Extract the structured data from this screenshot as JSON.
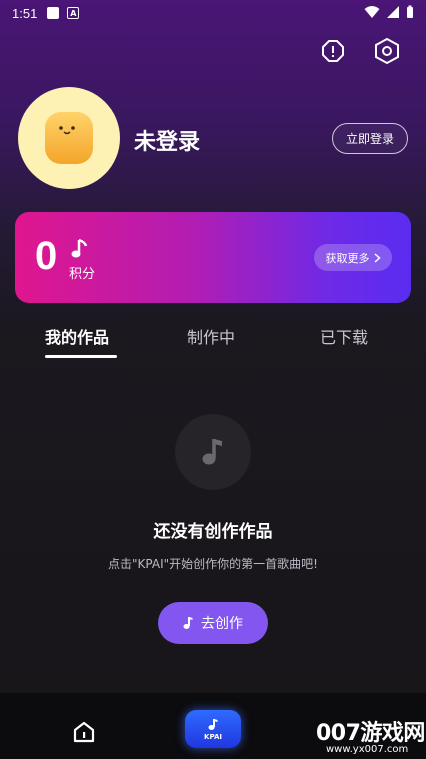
{
  "status_bar": {
    "time": "1:51",
    "app_badge": "A"
  },
  "header": {
    "alert_icon": "alert-circle-icon",
    "settings_icon": "hexagon-settings-icon"
  },
  "profile": {
    "username": "未登录",
    "login_button": "立即登录",
    "avatar_icon": "cute-tofu-avatar"
  },
  "points": {
    "value": "0",
    "label": "积分",
    "more_button": "获取更多"
  },
  "tabs": [
    {
      "label": "我的作品",
      "active": true
    },
    {
      "label": "制作中",
      "active": false
    },
    {
      "label": "已下载",
      "active": false
    }
  ],
  "empty_state": {
    "title": "还没有创作作品",
    "subtitle": "点击\"KPAI\"开始创作你的第一首歌曲吧!",
    "button": "去创作"
  },
  "bottom_nav": {
    "home_icon": "home-icon",
    "center_label": "KPAI",
    "third_icon": "profile-icon"
  },
  "watermark": {
    "text": "007游戏网",
    "url": "www.yx007.com"
  },
  "colors": {
    "accent": "#8356f0",
    "card_start": "#e0168e",
    "card_end": "#5a2cf0",
    "nav_blue": "#2f6bff"
  }
}
